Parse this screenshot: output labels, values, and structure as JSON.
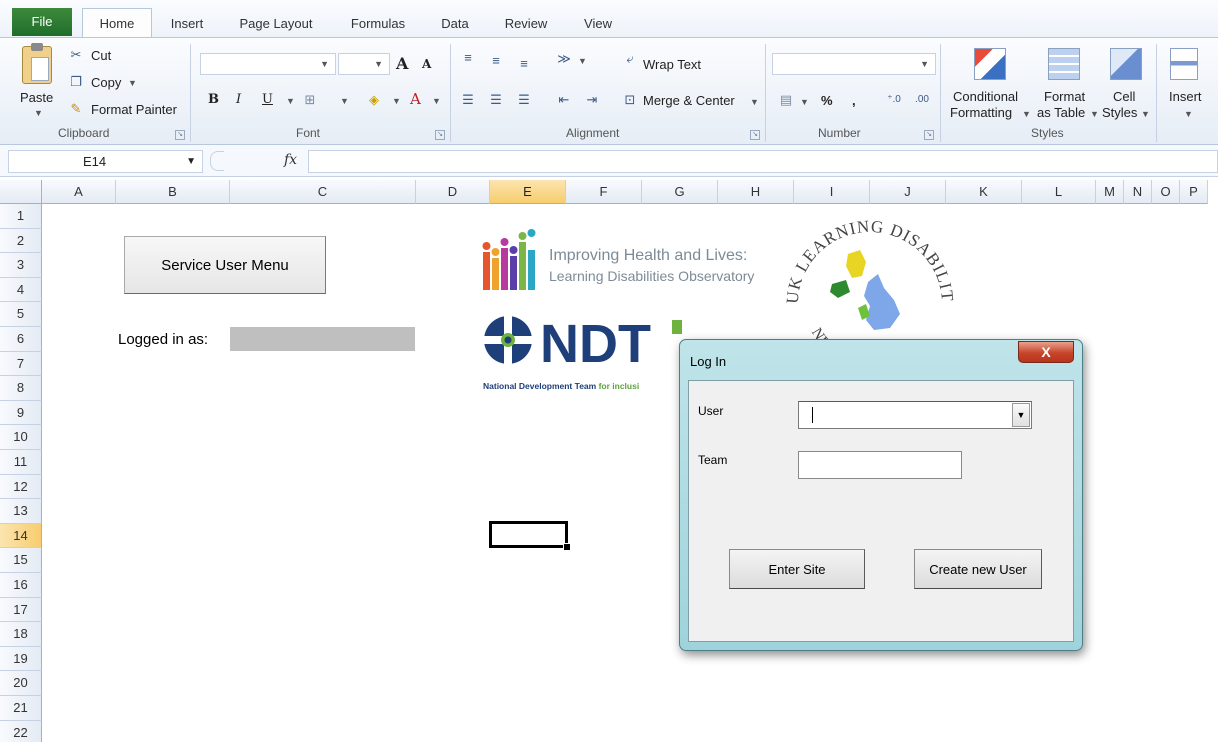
{
  "ribbon": {
    "tabs": [
      "File",
      "Home",
      "Insert",
      "Page Layout",
      "Formulas",
      "Data",
      "Review",
      "View"
    ],
    "clipboard": {
      "paste": "Paste",
      "cut": "Cut",
      "copy": "Copy",
      "format_painter": "Format Painter",
      "label": "Clipboard"
    },
    "font": {
      "label": "Font",
      "bold": "B",
      "italic": "I",
      "underline": "U",
      "grow": "A",
      "shrink": "A",
      "color": "A"
    },
    "alignment": {
      "wrap_text": "Wrap Text",
      "merge_center": "Merge & Center",
      "label": "Alignment"
    },
    "number": {
      "percent": "%",
      "comma": ",",
      "label": "Number"
    },
    "styles": {
      "conditional_1": "Conditional",
      "conditional_2": "Formatting",
      "format_table_1": "Format",
      "format_table_2": "as Table",
      "cell_styles_1": "Cell",
      "cell_styles_2": "Styles",
      "label": "Styles"
    },
    "cells": {
      "insert": "Insert"
    }
  },
  "formula_bar": {
    "name_box": "E14",
    "fx": "fx",
    "formula": ""
  },
  "columns": [
    "A",
    "B",
    "C",
    "D",
    "E",
    "F",
    "G",
    "H",
    "I",
    "J",
    "K",
    "L",
    "M",
    "N",
    "O",
    "P"
  ],
  "rows": [
    "1",
    "2",
    "3",
    "4",
    "5",
    "6",
    "7",
    "8",
    "9",
    "10",
    "11",
    "12",
    "13",
    "14",
    "15",
    "16",
    "17",
    "18",
    "19",
    "20",
    "21",
    "22"
  ],
  "selected": {
    "column": "E",
    "row": "14"
  },
  "sheet": {
    "service_user_menu": "Service User Menu",
    "logged_in_label": "Logged in as:",
    "logged_in_value": ""
  },
  "logos": {
    "ihl_line1": "Improving Health and Lives:",
    "ihl_line2": "Learning Disabilities Observatory",
    "ndti_name": "NDT",
    "ndti_sub_1": "National Development Team ",
    "ndti_sub_2": "for inclusi",
    "uk_ring_top": "UK LEARNING DISABILITY CONSULTANCY",
    "uk_ring_bottom": "NETWORK"
  },
  "dialog": {
    "title": "Log In",
    "close": "X",
    "user_label": "User",
    "user_value": "",
    "team_label": "Team",
    "team_value": "",
    "enter_button": "Enter Site",
    "create_button": "Create new User"
  },
  "colors": {
    "file_tab": "#2a7a33",
    "selection_header": "#f7cd6e",
    "dialog_frame": "#a9d9e0",
    "close_button": "#c7452b",
    "ndti_blue": "#1e3f7a"
  }
}
